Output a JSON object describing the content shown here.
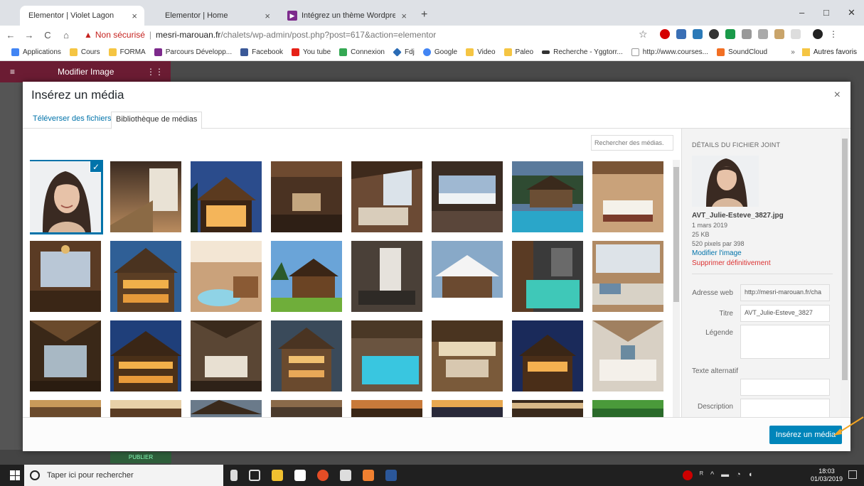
{
  "browser": {
    "tabs": [
      {
        "title": "Elementor | Violet Lagon",
        "close": "×"
      },
      {
        "title": "Elementor | Home",
        "close": "×"
      },
      {
        "title": "Intégrez un thème Wordpress pe",
        "close": "×"
      }
    ],
    "new_tab": "+",
    "window_controls": {
      "minimize": "–",
      "maximize": "□",
      "close": "✕"
    },
    "nav": {
      "back": "←",
      "forward": "→",
      "reload": "C",
      "home": "⌂"
    },
    "address": {
      "security_label": "Non sécurisé",
      "separator": "|",
      "host": "mesri-marouan.fr",
      "path": "/chalets/wp-admin/post.php?post=617&action=elementor"
    },
    "star": "☆",
    "bookmarks": [
      {
        "label": "Applications",
        "color": "#4285f4"
      },
      {
        "label": "Cours",
        "color": "#f5c543"
      },
      {
        "label": "FORMA",
        "color": "#f5c543"
      },
      {
        "label": "Parcours Développ...",
        "color": "#7d2a8c"
      },
      {
        "label": "Facebook",
        "color": "#3b5998"
      },
      {
        "label": "You tube",
        "color": "#e62117"
      },
      {
        "label": "Connexion",
        "color": "#34a853"
      },
      {
        "label": "Fdj",
        "color": "#2a6bb5"
      },
      {
        "label": "Google",
        "color": "#4285f4"
      },
      {
        "label": "Video",
        "color": "#f5c543"
      },
      {
        "label": "Paleo",
        "color": "#f5c543"
      },
      {
        "label": "Recherche - Yggtorr...",
        "color": "#333333"
      },
      {
        "label": "http://www.courses...",
        "color": "#cccccc"
      },
      {
        "label": "SoundCloud",
        "color": "#f26f23"
      }
    ],
    "bookmarks_more": "»",
    "other_bookmarks": "Autres favoris"
  },
  "elementor": {
    "panel_title": "Modifier Image",
    "publish": "PUBLIER"
  },
  "modal": {
    "title": "Insérez un média",
    "close": "×",
    "tabs": {
      "upload": "Téléverser des fichiers",
      "library": "Bibliothèque de médias"
    },
    "search_placeholder": "Rechercher des médias.",
    "selected_check": "✓",
    "details": {
      "heading": "DÉTAILS DU FICHIER JOINT",
      "filename": "AVT_Julie-Esteve_3827.jpg",
      "date": "1 mars 2019",
      "size": "25 KB",
      "dimensions": "520 pixels par 398",
      "edit_link": "Modifier l'image",
      "delete_link": "Supprimer définitivement",
      "url_label": "Adresse web",
      "url_value": "http://mesri-marouan.fr/cha",
      "title_label": "Titre",
      "title_value": "AVT_Julie-Esteve_3827",
      "caption_label": "Légende",
      "alt_label": "Texte alternatif",
      "description_label": "Description"
    },
    "insert_button": "Insérez un média"
  },
  "taskbar": {
    "search_placeholder": "Taper ici pour rechercher",
    "time": "18:03",
    "date": "01/03/2019"
  },
  "colors": {
    "wp_blue": "#0073aa",
    "button_blue": "#0085ba",
    "delete_red": "#dc3232",
    "elementor_magenta": "#6b1c33"
  }
}
